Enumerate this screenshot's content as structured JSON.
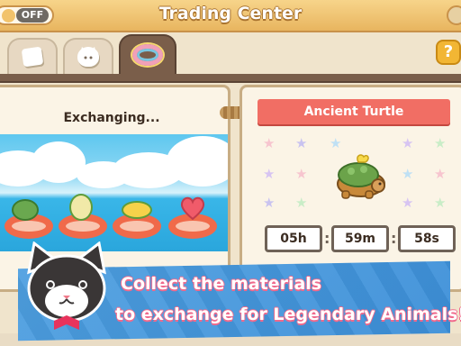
{
  "header": {
    "title": "Trading Center",
    "sound_toggle": "OFF"
  },
  "tabs": [
    {
      "icon": "box-icon",
      "active": false
    },
    {
      "icon": "cat-face-icon",
      "active": false
    },
    {
      "icon": "float-ring-icon",
      "active": true
    }
  ],
  "help_label": "?",
  "left_panel": {
    "status": "Exchanging..."
  },
  "right_panel": {
    "animal_name": "Ancient Turtle",
    "timer": {
      "hours": "05h",
      "minutes": "59m",
      "seconds": "58s"
    }
  },
  "banner": {
    "line1": "Collect the materials",
    "line2": "to exchange for Legendary Animals!"
  },
  "colors": {
    "accent": "#f16e64",
    "banner": "#4e9fe0",
    "header": "#e8b55f"
  }
}
